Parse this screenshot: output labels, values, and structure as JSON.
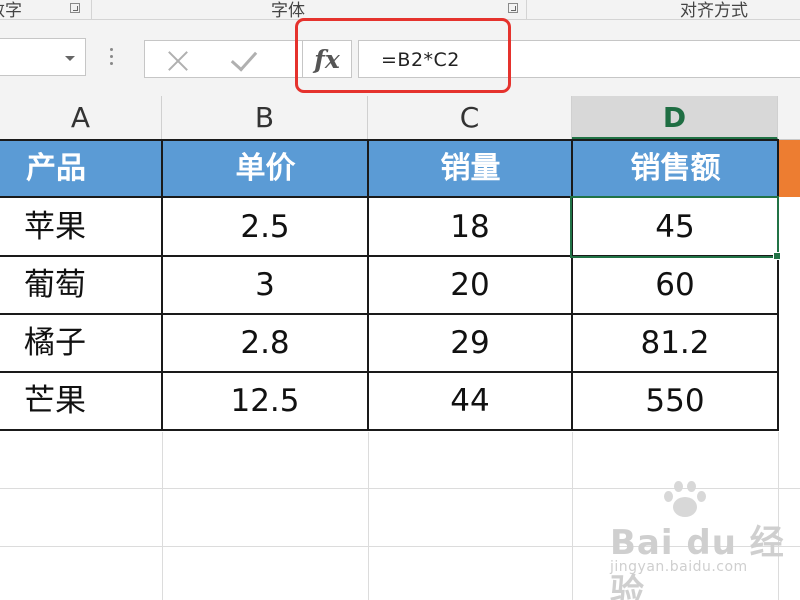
{
  "ribbon": {
    "groups": [
      "数字",
      "字体",
      "对齐方式"
    ]
  },
  "formula_bar": {
    "name_box_value": "",
    "cancel_icon": "cancel-x-icon",
    "enter_icon": "checkmark-icon",
    "fx_label": "fx",
    "formula": "=B2*C2",
    "highlight_color": "#e5322d"
  },
  "columns": [
    "A",
    "B",
    "C",
    "D"
  ],
  "active_column": "D",
  "table": {
    "headers": [
      "产品",
      "单价",
      "销量",
      "销售额"
    ],
    "header_color": "#5b9bd5",
    "rows": [
      [
        "苹果",
        "2.5",
        "18",
        "45"
      ],
      [
        "葡萄",
        "3",
        "20",
        "60"
      ],
      [
        "橘子",
        "2.8",
        "29",
        "81.2"
      ],
      [
        "芒果",
        "12.5",
        "44",
        "550"
      ]
    ]
  },
  "selected_cell": "D2",
  "accent": "#217346",
  "watermark": {
    "brand": "Bai du 经验",
    "url": "jingyan.baidu.com"
  }
}
